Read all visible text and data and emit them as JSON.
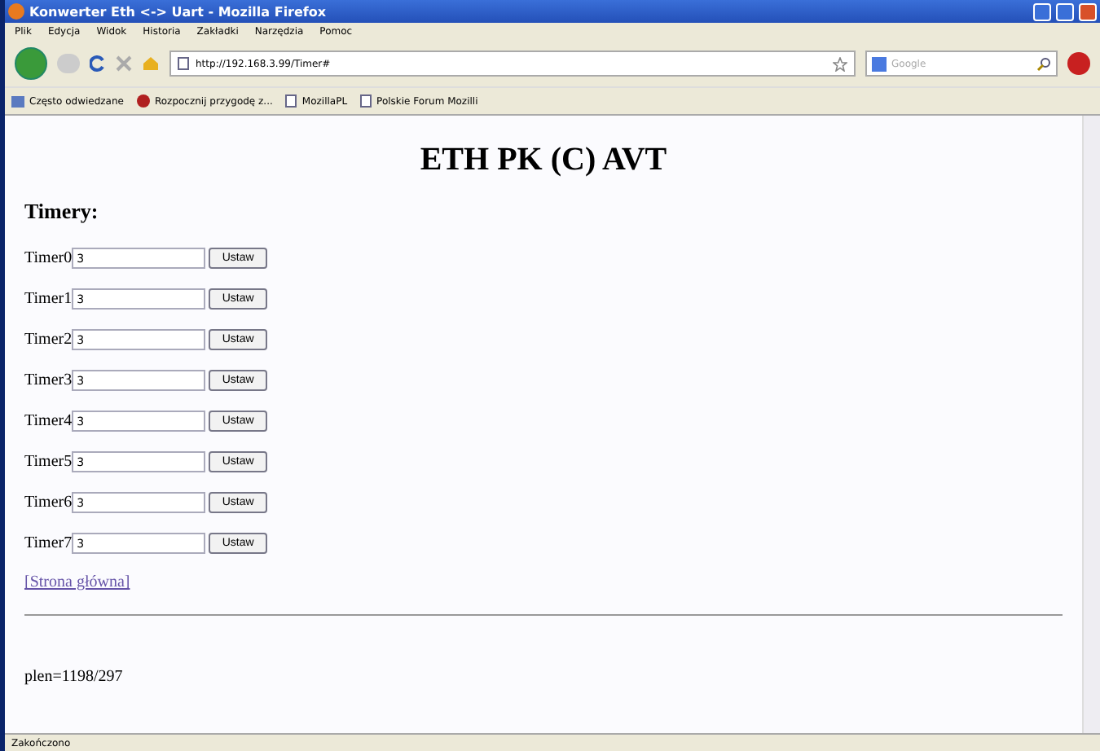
{
  "window": {
    "title": "Konwerter Eth <-> Uart - Mozilla Firefox"
  },
  "menu": [
    "Plik",
    "Edycja",
    "Widok",
    "Historia",
    "Zakładki",
    "Narzędzia",
    "Pomoc"
  ],
  "address_bar": {
    "value": "http://192.168.3.99/Timer#"
  },
  "search": {
    "placeholder": "Google"
  },
  "bookmarks": [
    {
      "label": "Często odwiedzane",
      "kind": "places"
    },
    {
      "label": "Rozpocznij przygodę z...",
      "kind": "fox"
    },
    {
      "label": "MozillaPL",
      "kind": "page"
    },
    {
      "label": "Polskie Forum Mozilli",
      "kind": "page"
    }
  ],
  "page": {
    "heading": "ETH PK (C) AVT",
    "section_title": "Timery:",
    "timers": [
      {
        "label": "Timer0",
        "value": "3",
        "button": "Ustaw"
      },
      {
        "label": "Timer1",
        "value": "3",
        "button": "Ustaw"
      },
      {
        "label": "Timer2",
        "value": "3",
        "button": "Ustaw"
      },
      {
        "label": "Timer3",
        "value": "3",
        "button": "Ustaw"
      },
      {
        "label": "Timer4",
        "value": "3",
        "button": "Ustaw"
      },
      {
        "label": "Timer5",
        "value": "3",
        "button": "Ustaw"
      },
      {
        "label": "Timer6",
        "value": "3",
        "button": "Ustaw"
      },
      {
        "label": "Timer7",
        "value": "3",
        "button": "Ustaw"
      }
    ],
    "link": "[Strona główna]",
    "footer": "plen=1198/297"
  },
  "status_bar": "Zakończono"
}
